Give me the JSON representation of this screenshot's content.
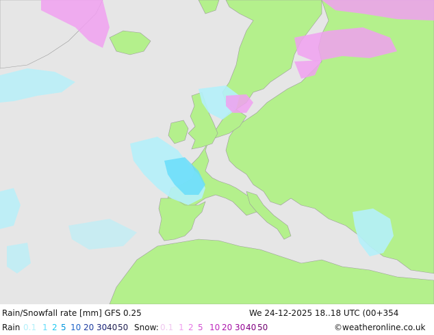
{
  "title": "Rain/Snowfall rate [mm] GFS 0.25",
  "valid_time": "We 24-12-2025 18..18 UTC (00+354",
  "credit": "©weatheronline.co.uk",
  "rain_legend": {
    "label": "Rain",
    "values": [
      "0.1",
      "1",
      "2",
      "5",
      "10",
      "20",
      "30",
      "40",
      "50"
    ],
    "colors": [
      "#b4f0fa",
      "#64dcfa",
      "#1ec8f0",
      "#0096dc",
      "#1e64c8",
      "#1e3ca0",
      "#141e78",
      "#1e1e50",
      "#1e1e50"
    ]
  },
  "snow_legend": {
    "label": "Snow:",
    "values": [
      "0.1",
      "1",
      "2",
      "5",
      "10",
      "20",
      "30",
      "40",
      "50"
    ],
    "colors": [
      "#f0c8f0",
      "#f0a0f0",
      "#e678e6",
      "#d250d2",
      "#be28be",
      "#aa14aa",
      "#960096",
      "#820082",
      "#6e006e"
    ]
  },
  "colors": {
    "sea": "#e6e6e6",
    "land": "#b4f08c",
    "border": "#9a9a9a",
    "rain_light": "#b4f0fa",
    "rain_mid": "#64dcfa",
    "snow": "#f0a0f0"
  }
}
